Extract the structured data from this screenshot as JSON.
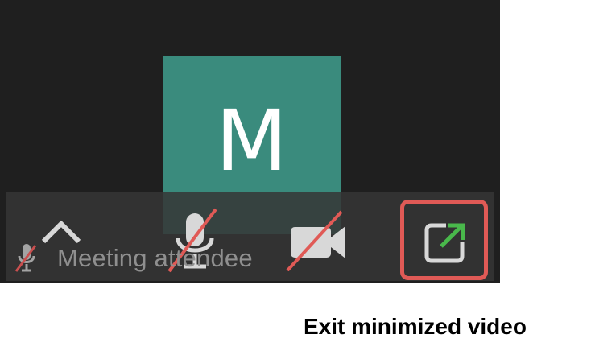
{
  "video": {
    "avatar_initial": "M",
    "attendee_name": "Meeting attendee"
  },
  "controls": {
    "expand_controls_icon": "chevron-up-icon",
    "microphone_icon": "microphone-muted-icon",
    "camera_icon": "video-camera-muted-icon",
    "exit_minimized_icon": "exit-minimized-video-icon"
  },
  "caption": {
    "text": "Exit minimized video"
  },
  "colors": {
    "window_background": "#1f1f1f",
    "avatar_tile": "#3a8b7d",
    "control_bar": "#363636",
    "muted_slash": "#e05a56",
    "highlight_outline": "#e05a56",
    "exit_arrow": "#49b84b",
    "icon_gray": "#d8d8d8",
    "attendee_text": "#8f8f8f"
  }
}
